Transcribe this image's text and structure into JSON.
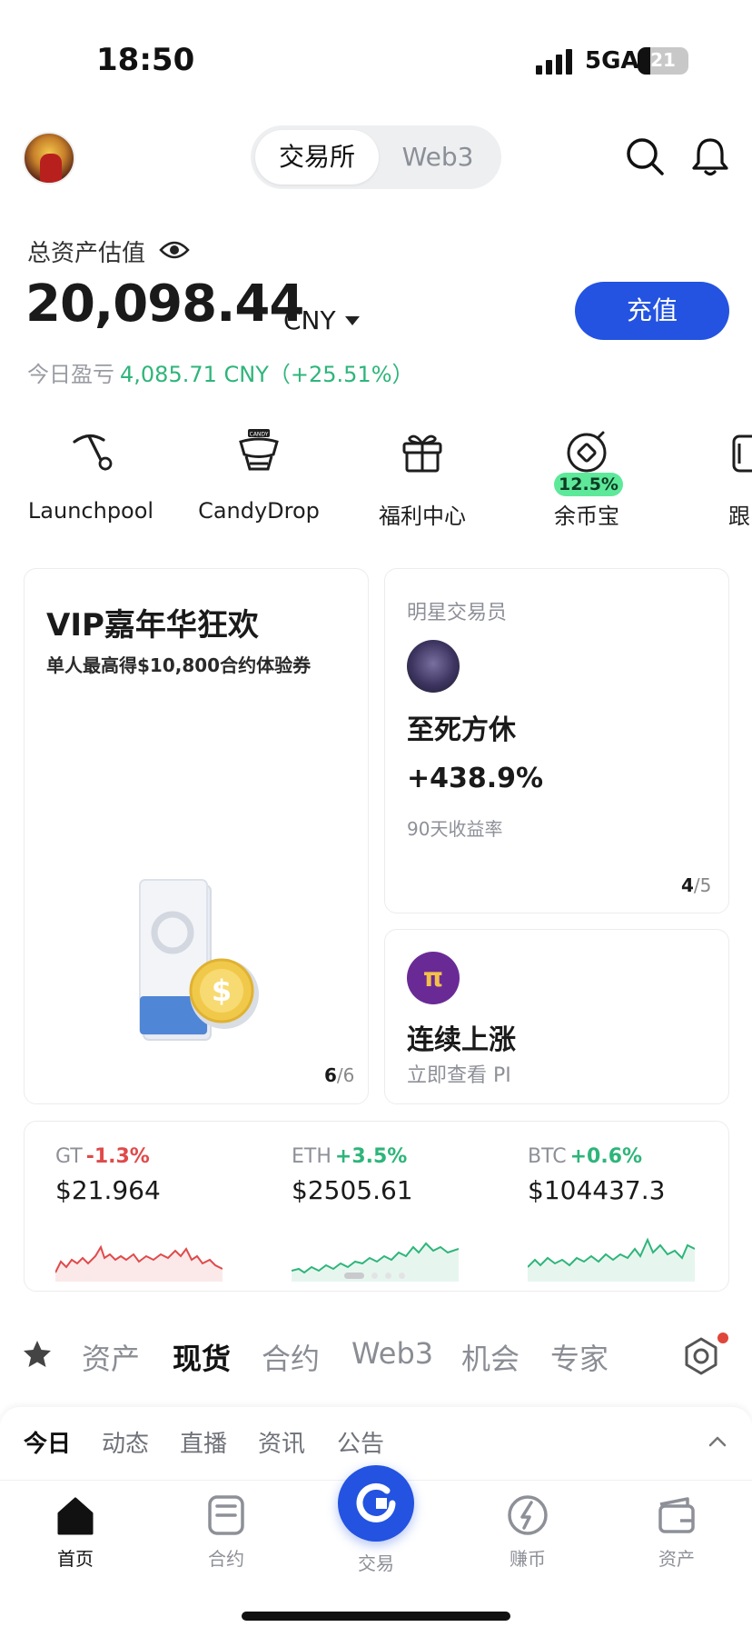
{
  "status_bar": {
    "time": "18:50",
    "network": "5GA",
    "battery": "21"
  },
  "header": {
    "segments": [
      "交易所",
      "Web3"
    ],
    "active_segment": "交易所"
  },
  "assets": {
    "label": "总资产估值",
    "value": "20,098.44",
    "currency": "CNY",
    "recharge_label": "充值",
    "pnl_label": "今日盈亏",
    "pnl_value": "4,085.71 CNY（+25.51%）"
  },
  "quick_actions": [
    {
      "label": "Launchpool",
      "icon": "pickaxe-icon"
    },
    {
      "label": "CandyDrop",
      "icon": "candy-icon"
    },
    {
      "label": "福利中心",
      "icon": "gift-icon"
    },
    {
      "label": "余币宝",
      "icon": "vault-icon",
      "badge": "12.5%"
    },
    {
      "label": "跟",
      "icon": "copy-trade-icon"
    }
  ],
  "vip_card": {
    "title": "VIP嘉年华狂欢",
    "subtitle": "单人最高得$10,800合约体验券",
    "page": "6",
    "total": "/6"
  },
  "star_trader": {
    "label": "明星交易员",
    "name": "至死方休",
    "return": "+438.9%",
    "return_label": "90天收益率",
    "page": "4",
    "total": "/5"
  },
  "pi_card": {
    "title": "连续上涨",
    "subtitle": "立即查看 PI",
    "logo": "π"
  },
  "tickers": [
    {
      "symbol": "GT",
      "change": "-1.3%",
      "price": "$21.964",
      "direction": "down",
      "color": "#e04a4a"
    },
    {
      "symbol": "ETH",
      "change": "+3.5%",
      "price": "$2505.61",
      "direction": "up",
      "color": "#2eb57a"
    },
    {
      "symbol": "BTC",
      "change": "+0.6%",
      "price": "$104437.3",
      "direction": "up",
      "color": "#2eb57a"
    }
  ],
  "categories": [
    "资产",
    "现货",
    "合约",
    "Web3",
    "机会",
    "专家"
  ],
  "active_category": "现货",
  "sub_tabs": [
    "今日",
    "动态",
    "直播",
    "资讯",
    "公告"
  ],
  "bottom_nav": [
    {
      "label": "首页",
      "icon": "home-icon"
    },
    {
      "label": "合约",
      "icon": "contract-icon"
    },
    {
      "label": "交易",
      "icon": "trade-icon"
    },
    {
      "label": "赚币",
      "icon": "earn-icon"
    },
    {
      "label": "资产",
      "icon": "wallet-icon"
    }
  ],
  "colors": {
    "brand_blue": "#2353e0",
    "up_green": "#2eb57a",
    "down_red": "#e04a4a",
    "badge_green": "#5ee89a"
  }
}
